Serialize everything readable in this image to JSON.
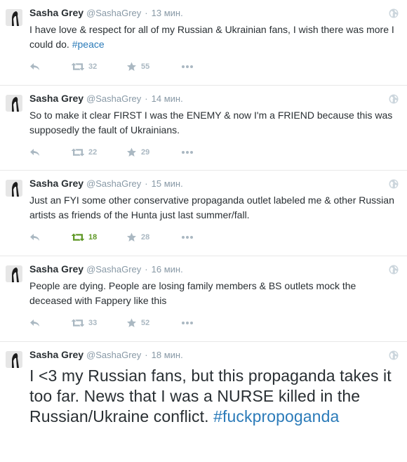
{
  "colors": {
    "text": "#292f33",
    "muted": "#8899a6",
    "icon": "#aab8c2",
    "hashtag": "#2b7bb9",
    "retweeted": "#609928"
  },
  "tweets": [
    {
      "name": "Sasha Grey",
      "handle": "@SashaGrey",
      "dot": "·",
      "time": "13 мин.",
      "text": "I have love & respect for all of my Russian & Ukrainian fans, I wish there was more I could do. ",
      "hashtag": "#peace",
      "retweets": "32",
      "favorites": "55",
      "retweeted": false
    },
    {
      "name": "Sasha Grey",
      "handle": "@SashaGrey",
      "dot": "·",
      "time": "14 мин.",
      "text": "So to make it clear FIRST I was the ENEMY & now I'm a FRIEND because this was supposedly the fault of Ukrainians.",
      "hashtag": "",
      "retweets": "22",
      "favorites": "29",
      "retweeted": false
    },
    {
      "name": "Sasha Grey",
      "handle": "@SashaGrey",
      "dot": "·",
      "time": "15 мин.",
      "text": "Just an FYI some other conservative propaganda outlet labeled me & other Russian artists as friends of the Hunta just last summer/fall.",
      "hashtag": "",
      "retweets": "18",
      "favorites": "28",
      "retweeted": true
    },
    {
      "name": "Sasha Grey",
      "handle": "@SashaGrey",
      "dot": "·",
      "time": "16 мин.",
      "text": "People are dying. People are losing family members & BS outlets mock the deceased with Fappery like this",
      "hashtag": "",
      "retweets": "33",
      "favorites": "52",
      "retweeted": false
    },
    {
      "name": "Sasha Grey",
      "handle": "@SashaGrey",
      "dot": "·",
      "time": "18 мин.",
      "text": "I <3 my Russian fans, but this propaganda takes it too far. News that I was a NURSE killed in the Russian/Ukraine conflict. ",
      "hashtag": "#fuckpropoganda",
      "retweets": "",
      "favorites": "",
      "retweeted": false
    }
  ]
}
